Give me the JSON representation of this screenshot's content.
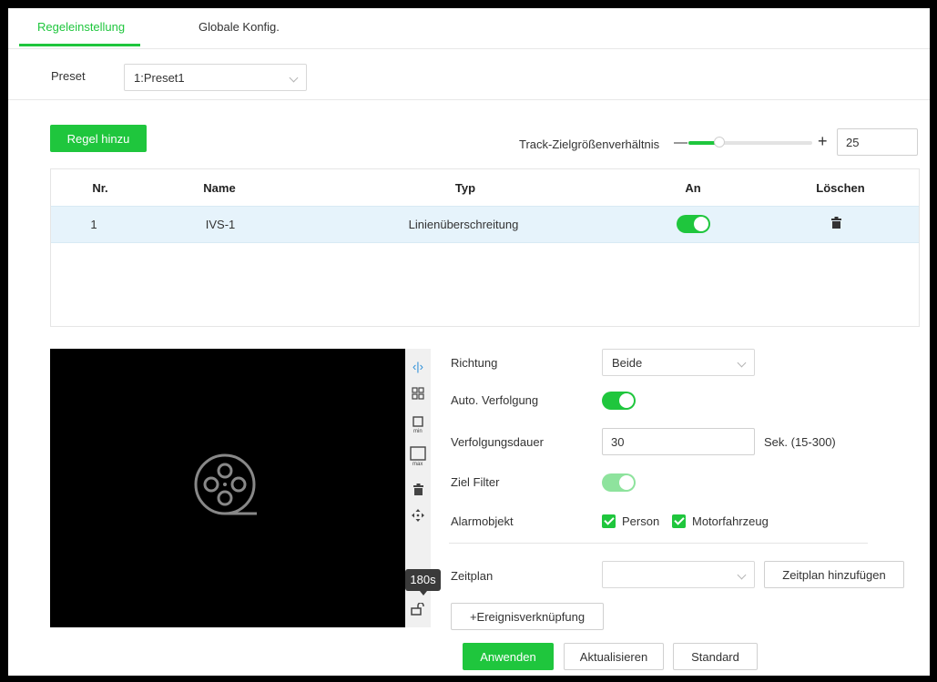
{
  "tabs": [
    {
      "label": "Regeleinstellung",
      "active": true
    },
    {
      "label": "Globale Konfig.",
      "active": false
    }
  ],
  "preset": {
    "label": "Preset",
    "value": "1:Preset1"
  },
  "rules": {
    "add_button": "Regel hinzu",
    "track_ratio_label": "Track-Zielgrößenverhältnis",
    "track_ratio_value": "25",
    "track_ratio_min_symbol": "—",
    "track_ratio_max_symbol": "+"
  },
  "table": {
    "columns": [
      "Nr.",
      "Name",
      "Typ",
      "An",
      "Löschen"
    ],
    "rows": [
      {
        "nr": "1",
        "name": "IVS-1",
        "typ": "Linienüberschreitung",
        "enabled": true,
        "delete_icon": "trash-icon"
      }
    ]
  },
  "video_toolbar": {
    "icons": [
      "direction-arrows-icon",
      "grid-select-icon",
      "min-size-icon",
      "max-size-icon",
      "trash-icon",
      "move-icon",
      "lock-open-icon"
    ],
    "min_label": "min",
    "max_label": "max",
    "tooltip": "180s"
  },
  "settings": {
    "richtung": {
      "label": "Richtung",
      "value": "Beide"
    },
    "auto_verfolgung": {
      "label": "Auto. Verfolgung",
      "enabled": true
    },
    "verfolgungsdauer": {
      "label": "Verfolgungsdauer",
      "value": "30",
      "unit": "Sek. (15-300)"
    },
    "ziel_filter": {
      "label": "Ziel Filter",
      "enabled": true,
      "disabled": true
    },
    "alarmobjekt": {
      "label": "Alarmobjekt",
      "options": [
        {
          "label": "Person",
          "checked": true
        },
        {
          "label": "Motorfahrzeug",
          "checked": true
        }
      ]
    },
    "zeitplan": {
      "label": "Zeitplan",
      "value": "",
      "add_button": "Zeitplan hinzufügen"
    },
    "event_link_button": "+Ereignisverknüpfung"
  },
  "footer": {
    "apply": "Anwenden",
    "refresh": "Aktualisieren",
    "default": "Standard"
  },
  "colors": {
    "accent": "#1fc63d",
    "row_highlight": "#e6f3fb"
  }
}
